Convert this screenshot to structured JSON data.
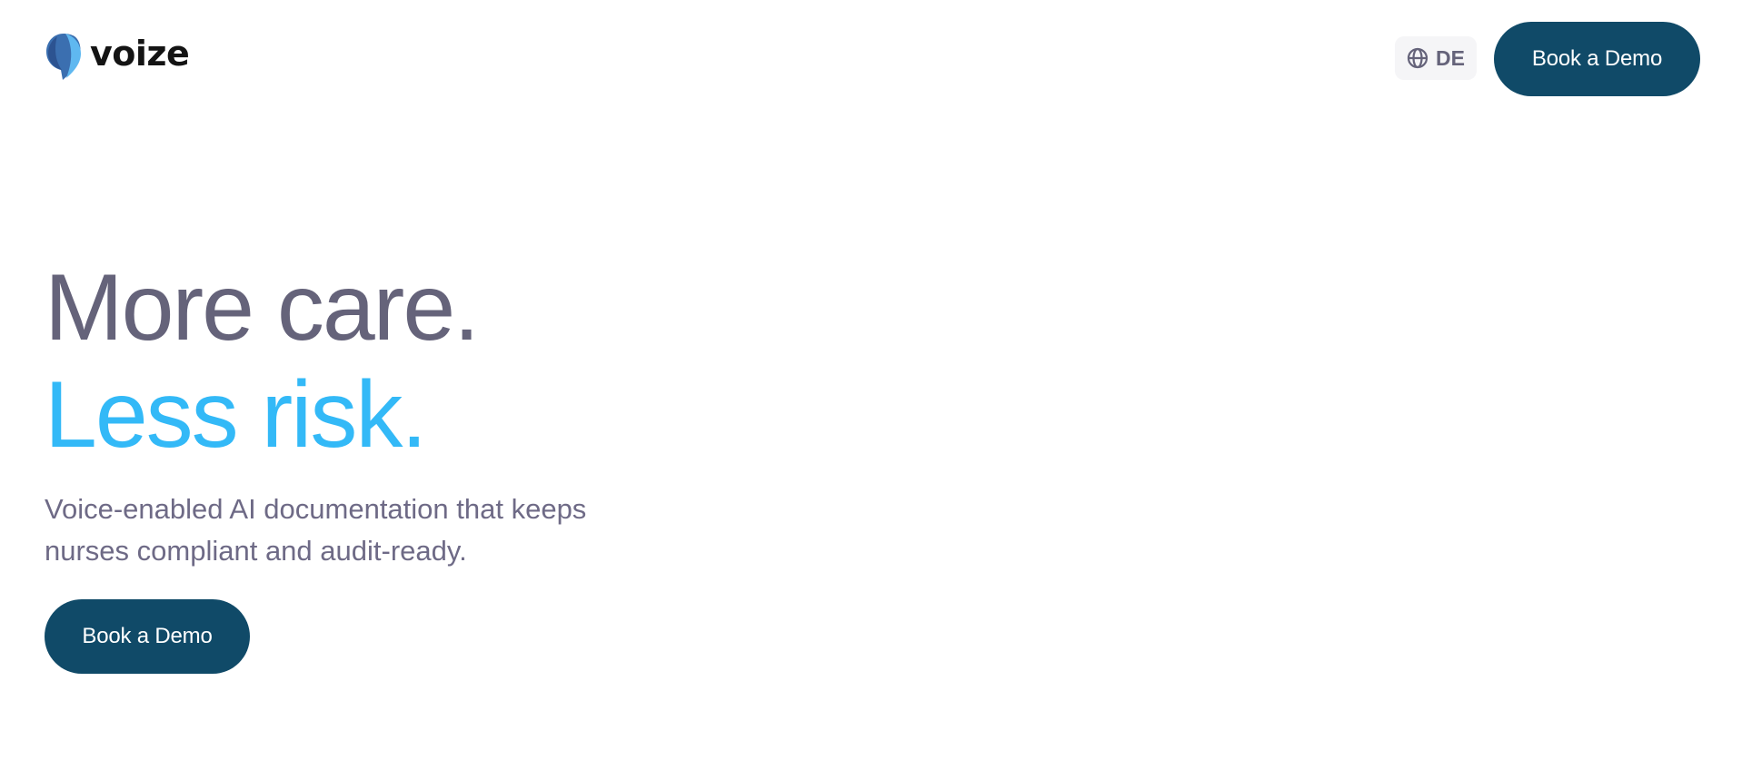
{
  "header": {
    "logo_text": "voize",
    "language_label": "DE",
    "cta_label": "Book a Demo"
  },
  "hero": {
    "headline_line1": "More care.",
    "headline_line2": "Less risk.",
    "subheadline": "Voice-enabled AI documentation that keeps nurses compliant and audit-ready.",
    "cta_label": "Book a Demo"
  },
  "icons": {
    "language": "globe-icon",
    "logo": "voize-speech-bubble-logo"
  },
  "colors": {
    "primary_button": "#104a68",
    "button_text": "#ffffff",
    "headline_gray": "#65637a",
    "headline_accent": "#33b9f7",
    "body_text": "#6e6a86",
    "logo_text": "#141414",
    "language_bg": "#f5f5f7"
  }
}
